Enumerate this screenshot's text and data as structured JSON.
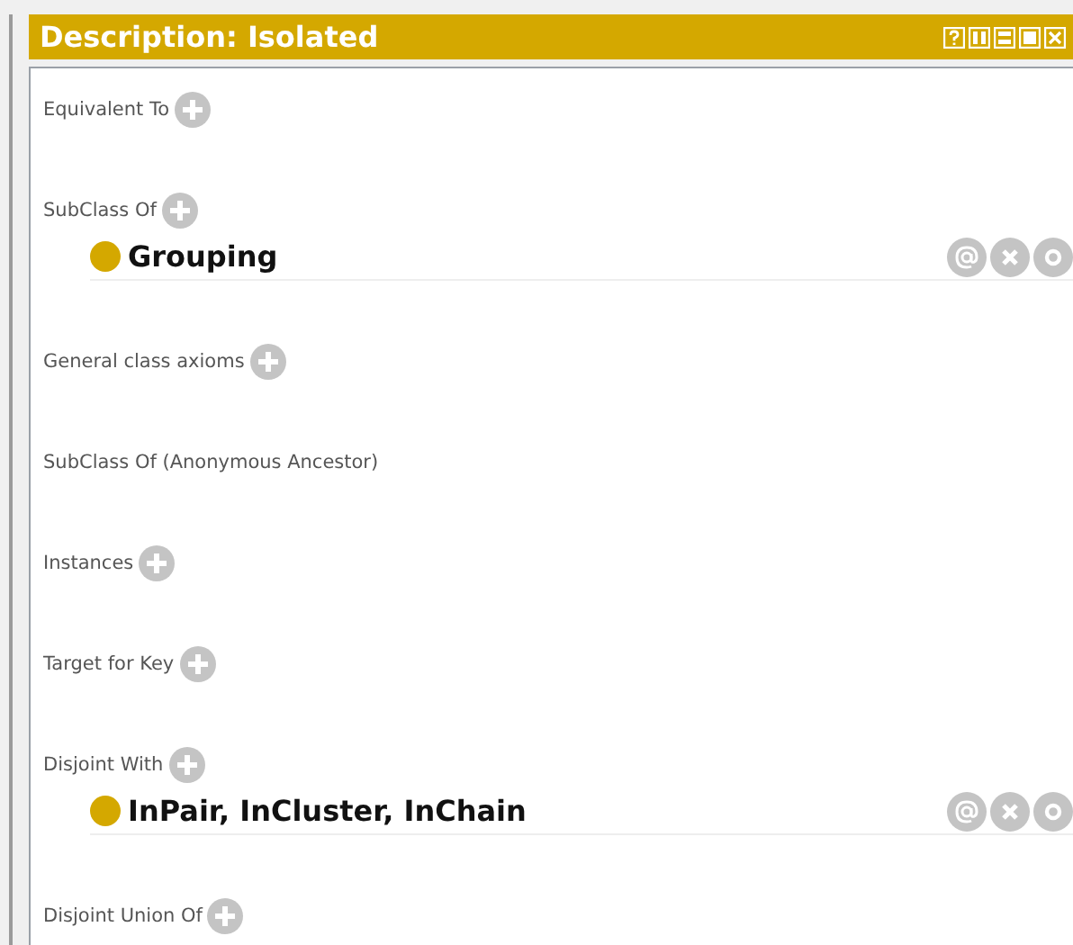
{
  "window": {
    "title": "Description: Isolated"
  },
  "sections": [
    {
      "label": "Equivalent To",
      "addable": true
    },
    {
      "label": "SubClass Of",
      "addable": true,
      "items": [
        {
          "text": "Grouping",
          "color": "#d4a800"
        }
      ]
    },
    {
      "label": "General class axioms",
      "addable": true
    },
    {
      "label": "SubClass Of (Anonymous Ancestor)",
      "addable": false
    },
    {
      "label": "Instances",
      "addable": true
    },
    {
      "label": "Target for Key",
      "addable": true
    },
    {
      "label": "Disjoint With",
      "addable": true,
      "items": [
        {
          "text": "InPair, InCluster, InChain",
          "color": "#d4a800"
        }
      ]
    },
    {
      "label": "Disjoint Union Of",
      "addable": true
    }
  ]
}
